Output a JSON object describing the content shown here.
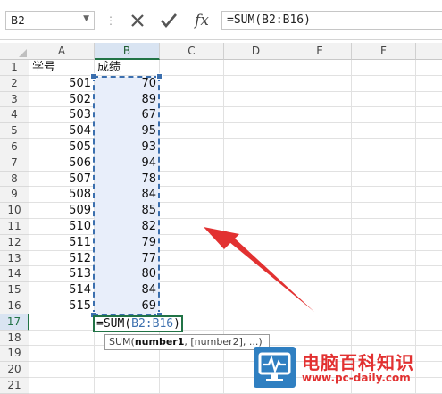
{
  "namebox": {
    "value": "B2"
  },
  "formula_bar": {
    "cancel_icon": "close-icon",
    "enter_icon": "check-icon",
    "fx_label": "fx",
    "formula": "=SUM(B2:B16)"
  },
  "columns": [
    "A",
    "B",
    "C",
    "D",
    "E",
    "F"
  ],
  "rows": [
    "1",
    "2",
    "3",
    "4",
    "5",
    "6",
    "7",
    "8",
    "9",
    "10",
    "11",
    "12",
    "13",
    "14",
    "15",
    "16",
    "17",
    "18",
    "19",
    "20",
    "21"
  ],
  "cells": {
    "A1": "学号",
    "B1": "成绩",
    "A": [
      "501",
      "502",
      "503",
      "504",
      "505",
      "506",
      "507",
      "508",
      "509",
      "510",
      "511",
      "512",
      "513",
      "514",
      "515"
    ],
    "B": [
      "70",
      "89",
      "67",
      "95",
      "93",
      "94",
      "78",
      "84",
      "85",
      "82",
      "79",
      "77",
      "80",
      "84",
      "69"
    ]
  },
  "active_cell": {
    "prefix": "=SUM(",
    "range": "B2:B16",
    "suffix": ")"
  },
  "tooltip": {
    "fn": "SUM(",
    "arg1": "number1",
    "rest": ", [number2], ...)"
  },
  "watermark": {
    "title": "电脑百科知识",
    "url": "www.pc-daily.com"
  },
  "colors": {
    "excel_green": "#217346",
    "selection_blue": "#3b6fae",
    "arrow_red": "#e23131"
  }
}
